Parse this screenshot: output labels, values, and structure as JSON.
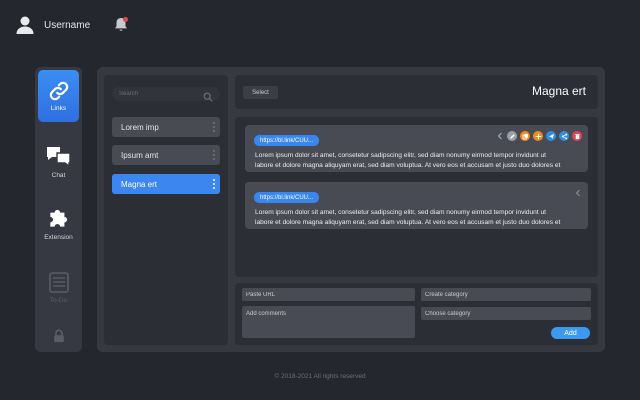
{
  "header": {
    "username": "Username"
  },
  "nav": {
    "items": [
      {
        "label": "Links",
        "icon": "link-icon",
        "state": "active"
      },
      {
        "label": "Chat",
        "icon": "chat-icon",
        "state": "normal"
      },
      {
        "label": "Extension",
        "icon": "puzzle-icon",
        "state": "normal"
      },
      {
        "label": "To-Do",
        "icon": "todo-list-icon",
        "state": "disabled"
      },
      {
        "label": "",
        "icon": "lock-icon",
        "state": "disabled"
      }
    ]
  },
  "list": {
    "search_placeholder": "Search",
    "items": [
      {
        "label": "Lorem imp",
        "active": false
      },
      {
        "label": "Ipsum amt",
        "active": false
      },
      {
        "label": "Magna ert",
        "active": true
      }
    ]
  },
  "content": {
    "select_label": "Select",
    "title": "Magna ert",
    "cards": [
      {
        "url": "https://bl.link/CUU...",
        "line1": "Lorem ipsum dolor sit amet, consetetur sadipscing elitr, sed diam nonumy eirmod tempor invidunt ut",
        "line2": "labore et dolore magna aliquyam erat, sed diam voluptua. At vero eos et accusam et justo duo dolores et",
        "expanded": true
      },
      {
        "url": "https://bl.link/CUU...",
        "line1": "Lorem ipsum dolor sit amet, consetetur sadipscing elitr, sed diam nonumy eirmod tempor invidunt ut",
        "line2": "labore et dolore magna aliquyam erat, sed diam voluptua. At vero eos et accusam et justo duo dolores et",
        "expanded": false
      }
    ],
    "tools": [
      {
        "icon": "edit-icon",
        "color": "#9aa0aa"
      },
      {
        "icon": "copy-icon",
        "color": "#f08a1c"
      },
      {
        "icon": "move-icon",
        "color": "#f08a1c"
      },
      {
        "icon": "send-icon",
        "color": "#2f8de4"
      },
      {
        "icon": "share-icon",
        "color": "#2f8de4"
      },
      {
        "icon": "trash-icon",
        "color": "#e0445a"
      }
    ]
  },
  "form": {
    "url_placeholder": "Paste URL",
    "comments_placeholder": "Add comments",
    "create_category_placeholder": "Create category",
    "choose_category_placeholder": "Choose category",
    "add_label": "Add"
  },
  "footer": {
    "copyright": "© 2018-2021 All rights reserved"
  },
  "colors": {
    "accent": "#3a86ef",
    "background": "#25272e",
    "panel": "#363941",
    "danger": "#e0445a",
    "warning": "#f08a1c"
  }
}
